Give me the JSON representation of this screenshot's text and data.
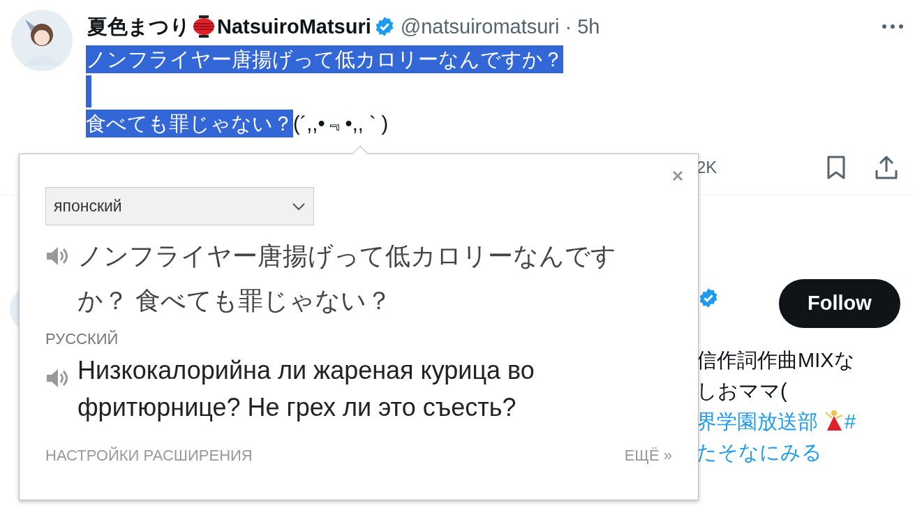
{
  "tweet": {
    "display_name": "夏色まつり",
    "name_suffix": "NatsuiroMatsuri",
    "handle": "@natsuiromatsuri",
    "separator": "·",
    "time": "5h",
    "lines": [
      {
        "segments": [
          {
            "text": "ノンフライヤー唐揚げって低カロリーなんですか？",
            "selected": true
          }
        ]
      },
      {
        "blank_selected": true
      },
      {
        "segments": [
          {
            "text": "食べても罪じゃない？",
            "selected": true
          },
          {
            "text": "(´,,•﹃•,, ` )",
            "selected": false
          }
        ]
      }
    ],
    "action_count": "2K"
  },
  "suggestion": {
    "follow_button": "Follow",
    "bio_lines": [
      {
        "text": "信作詞作曲MIXな",
        "kind": "plain"
      },
      {
        "text": "しおママ(",
        "kind": "plain"
      },
      {
        "text": "界学園放送部",
        "kind": "link",
        "emoji": true,
        "trailing": "#"
      },
      {
        "text": "たそなにみる",
        "kind": "link"
      }
    ]
  },
  "translator": {
    "source_language": "японский",
    "source_text": "ノンフライヤー唐揚げって低カロリーなんですか？ 食べても罪じゃない？",
    "target_language": "РУССКИЙ",
    "translation": "Низкокалорийна ли жареная курица во фритюрнице? Не грех ли это съесть?",
    "settings_link": "НАСТРОЙКИ РАСШИРЕНИЯ",
    "more_link": "ЕЩЁ »"
  }
}
